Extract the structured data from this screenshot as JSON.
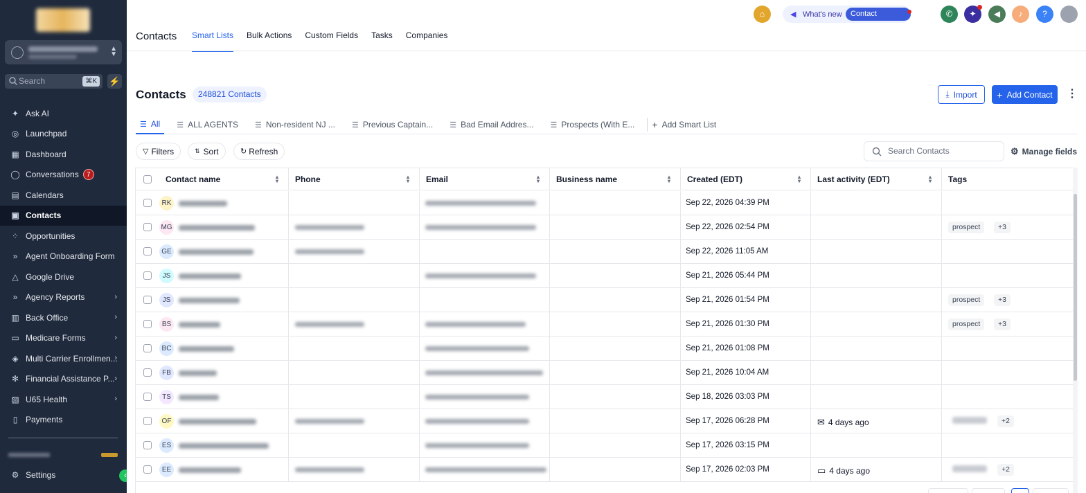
{
  "sidebar": {
    "search_placeholder": "Search",
    "search_shortcut": "⌘K",
    "items": [
      {
        "label": "Ask AI",
        "icon": "sparkles-icon",
        "glyph": "✦"
      },
      {
        "label": "Launchpad",
        "icon": "rocket-icon",
        "glyph": "◎"
      },
      {
        "label": "Dashboard",
        "icon": "dashboard-icon",
        "glyph": "▦"
      },
      {
        "label": "Conversations",
        "icon": "chat-icon",
        "glyph": "◯",
        "badge": "7"
      },
      {
        "label": "Calendars",
        "icon": "calendar-icon",
        "glyph": "▤"
      },
      {
        "label": "Contacts",
        "icon": "contacts-icon",
        "glyph": "▣",
        "active": true
      },
      {
        "label": "Opportunities",
        "icon": "opportunities-icon",
        "glyph": "⁘"
      },
      {
        "label": "Agent Onboarding Form",
        "icon": "double-chevron-icon",
        "glyph": "»"
      },
      {
        "label": "Google Drive",
        "icon": "drive-icon",
        "glyph": "△"
      },
      {
        "label": "Agency Reports",
        "icon": "double-chevron-icon",
        "glyph": "»",
        "expandable": true
      },
      {
        "label": "Back Office",
        "icon": "office-icon",
        "glyph": "▥",
        "expandable": true
      },
      {
        "label": "Medicare Forms",
        "icon": "folder-icon",
        "glyph": "▭",
        "expandable": true
      },
      {
        "label": "Multi Carrier Enrollmen...",
        "icon": "layers-icon",
        "glyph": "◈",
        "expandable": true
      },
      {
        "label": "Financial Assistance P...",
        "icon": "gear-icon",
        "glyph": "✻",
        "expandable": true
      },
      {
        "label": "U65 Health",
        "icon": "briefcase-icon",
        "glyph": "▨",
        "expandable": true
      },
      {
        "label": "Payments",
        "icon": "receipt-icon",
        "glyph": "▯"
      }
    ],
    "settings_label": "Settings"
  },
  "topbar": {
    "title": "Contacts",
    "tabs": [
      "Smart Lists",
      "Bulk Actions",
      "Custom Fields",
      "Tasks",
      "Companies"
    ],
    "active_tab": "Smart Lists",
    "whats_new": "What's new",
    "contact_updates": "Contact updates"
  },
  "main": {
    "heading": "Contacts",
    "count_badge": "248821 Contacts",
    "import_label": "Import",
    "add_contact_label": "Add Contact",
    "list_tabs": [
      "All",
      "ALL AGENTS",
      "Non-resident NJ ...",
      "Previous Captain...",
      "Bad Email Addres...",
      "Prospects (With E..."
    ],
    "add_smart_list": "Add Smart List",
    "filters_label": "Filters",
    "sort_label": "Sort",
    "refresh_label": "Refresh",
    "search_placeholder": "Search Contacts",
    "manage_fields_label": "Manage fields"
  },
  "table": {
    "columns": [
      "Contact name",
      "Phone",
      "Email",
      "Business name",
      "Created (EDT)",
      "Last activity (EDT)",
      "Tags"
    ],
    "rows": [
      {
        "initials": "RK",
        "avatar_color": "#fef3c7",
        "has_phone": false,
        "has_email": true,
        "created": "Sep 22, 2026 04:39 PM",
        "activity": "",
        "tags": []
      },
      {
        "initials": "MG",
        "avatar_color": "#fce7f3",
        "has_phone": true,
        "has_email": true,
        "created": "Sep 22, 2026 02:54 PM",
        "activity": "",
        "tags": [
          "prospect",
          "+3"
        ]
      },
      {
        "initials": "GE",
        "avatar_color": "#dbeafe",
        "has_phone": true,
        "has_email": false,
        "created": "Sep 22, 2026 11:05 AM",
        "activity": "",
        "tags": []
      },
      {
        "initials": "JS",
        "avatar_color": "#cffafe",
        "has_phone": false,
        "has_email": true,
        "created": "Sep 21, 2026 05:44 PM",
        "activity": "",
        "tags": []
      },
      {
        "initials": "JS",
        "avatar_color": "#e0e7ff",
        "has_phone": false,
        "has_email": false,
        "created": "Sep 21, 2026 01:54 PM",
        "activity": "",
        "tags": [
          "prospect",
          "+3"
        ]
      },
      {
        "initials": "BS",
        "avatar_color": "#fce7f3",
        "has_phone": true,
        "has_email": true,
        "created": "Sep 21, 2026 01:30 PM",
        "activity": "",
        "tags": [
          "prospect",
          "+3"
        ]
      },
      {
        "initials": "BC",
        "avatar_color": "#dbeafe",
        "has_phone": false,
        "has_email": true,
        "created": "Sep 21, 2026 01:08 PM",
        "activity": "",
        "tags": []
      },
      {
        "initials": "FB",
        "avatar_color": "#e0e7ff",
        "has_phone": false,
        "has_email": true,
        "created": "Sep 21, 2026 10:04 AM",
        "activity": "",
        "tags": []
      },
      {
        "initials": "TS",
        "avatar_color": "#f3e8ff",
        "has_phone": false,
        "has_email": true,
        "created": "Sep 18, 2026 03:03 PM",
        "activity": "",
        "tags": []
      },
      {
        "initials": "OF",
        "avatar_color": "#fef9c3",
        "has_phone": true,
        "has_email": true,
        "created": "Sep 17, 2026 06:28 PM",
        "activity": "4 days ago",
        "activity_icon": "mail-icon",
        "tags": [
          "blurred",
          "+2"
        ]
      },
      {
        "initials": "ES",
        "avatar_color": "#dbeafe",
        "has_phone": false,
        "has_email": true,
        "created": "Sep 17, 2026 03:15 PM",
        "activity": "",
        "tags": []
      },
      {
        "initials": "EE",
        "avatar_color": "#dbeafe",
        "has_phone": true,
        "has_email": true,
        "created": "Sep 17, 2026 02:03 PM",
        "activity": "4 days ago",
        "activity_icon": "comment-icon",
        "tags": [
          "blurred",
          "+2"
        ]
      }
    ]
  }
}
